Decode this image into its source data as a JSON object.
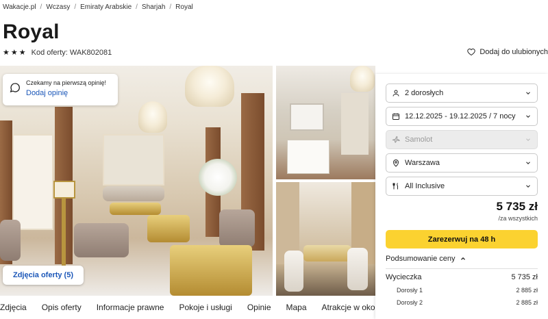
{
  "breadcrumb": [
    "Wakacje.pl",
    "Wczasy",
    "Emiraty Arabskie",
    "Sharjah",
    "Royal"
  ],
  "hotel": {
    "name": "Royal",
    "stars": 3,
    "offer_code": "Kod oferty: WAK802081",
    "favorite_label": "Dodaj do ulubionych"
  },
  "review_card": {
    "line1": "Czekamy na pierwszą opinię!",
    "link": "Dodaj opinię"
  },
  "gallery": {
    "photos_button": "Zdjęcia oferty (5)"
  },
  "tabs": [
    "Zdjęcia",
    "Opis oferty",
    "Informacje prawne",
    "Pokoje i usługi",
    "Opinie",
    "Mapa",
    "Atrakcje w okolicy"
  ],
  "booking": {
    "travelers": "2 dorosłych",
    "dates": "12.12.2025 - 19.12.2025 / 7 nocy",
    "transport": "Samolot",
    "departure": "Warszawa",
    "board": "All Inclusive",
    "price": "5 735 zł",
    "price_note": "/za wszystkich",
    "book_button": "Zarezerwuj na 48 h",
    "summary_label": "Podsumowanie ceny",
    "lines": [
      {
        "label": "Wycieczka",
        "value": "5 735 zł"
      },
      {
        "label": "Dorosły 1",
        "value": "2 885 zł"
      },
      {
        "label": "Dorosły 2",
        "value": "2 885 zł"
      }
    ]
  },
  "colors": {
    "accent_yellow": "#fbd230",
    "link_blue": "#1a56b8"
  }
}
